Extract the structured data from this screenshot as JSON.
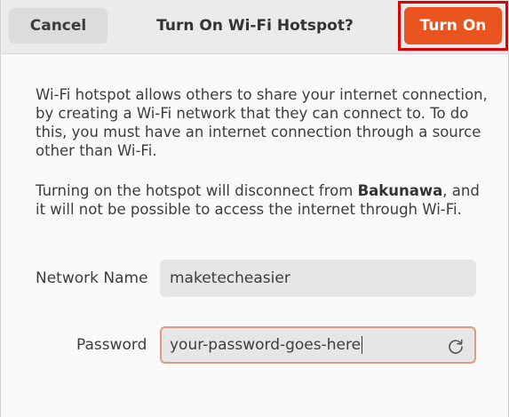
{
  "header": {
    "title": "Turn On Wi-Fi Hotspot?",
    "cancel_label": "Cancel",
    "turn_on_label": "Turn On"
  },
  "body": {
    "paragraph1": "Wi-Fi hotspot allows others to share your internet connection, by creating a Wi-Fi network that they can connect to. To do this, you must have an internet connection through a source other than Wi-Fi.",
    "paragraph2_before": "Turning on the hotspot will disconnect from ",
    "paragraph2_network": "Bakunawa",
    "paragraph2_after": ", and it will not be possible to access the internet through Wi-Fi."
  },
  "form": {
    "network_name_label": "Network Name",
    "network_name_value": "maketecheasier",
    "password_label": "Password",
    "password_value": "your-password-goes-here",
    "refresh_icon": "refresh-icon"
  },
  "colors": {
    "accent": "#e95420",
    "highlight_border": "#e00000",
    "focus_border": "#e29a80"
  }
}
